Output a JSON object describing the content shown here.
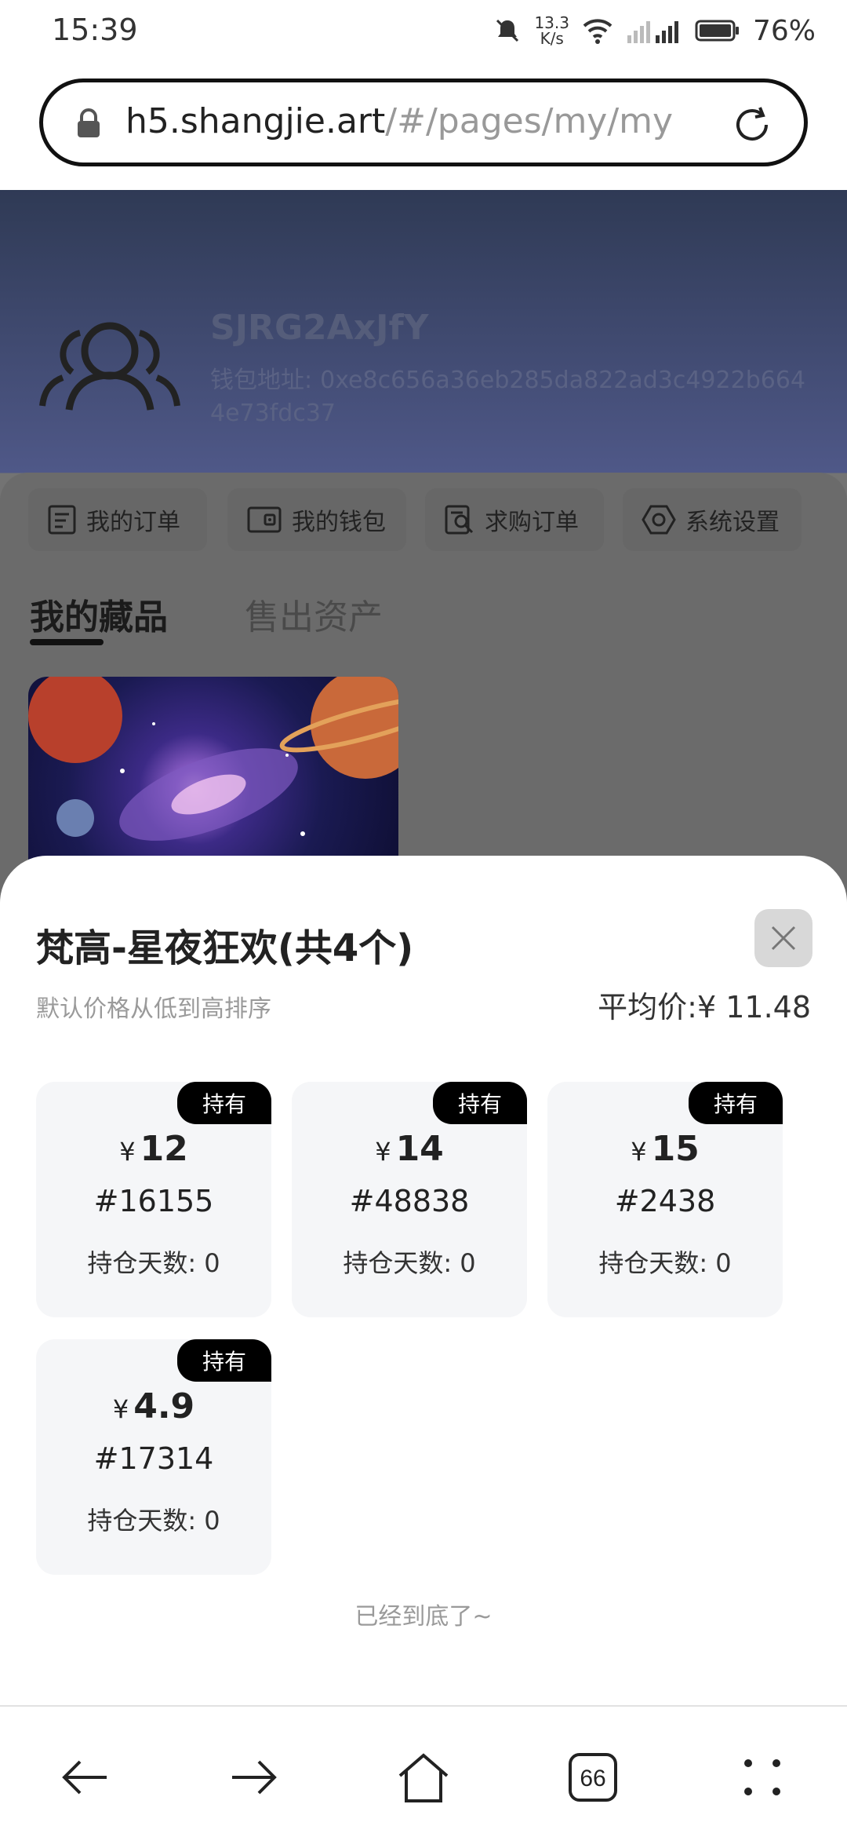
{
  "status_bar": {
    "time": "15:39",
    "net_speed_value": "13.3",
    "net_speed_unit": "K/s",
    "battery": "76%",
    "icons": [
      "mute-icon",
      "wifi-icon",
      "signal-icon",
      "battery-icon"
    ]
  },
  "url_bar": {
    "domain": "h5.shangjie.art",
    "path": "/#/pages/my/my"
  },
  "profile": {
    "name": "SJRG2AxJfY",
    "wallet_label": "钱包地址:",
    "wallet_address": "0xe8c656a36eb285da822ad3c4922b6644e73fdc37"
  },
  "quick_actions": [
    {
      "label": "我的订单",
      "icon": "orders-icon"
    },
    {
      "label": "我的钱包",
      "icon": "wallet-icon"
    },
    {
      "label": "求购订单",
      "icon": "purchase-order-icon"
    },
    {
      "label": "系统设置",
      "icon": "settings-icon"
    }
  ],
  "tabs": {
    "active": "我的藏品",
    "inactive": "售出资产"
  },
  "sheet": {
    "title": "梵高-星夜狂欢(共4个)",
    "sort_hint": "默认价格从低到高排序",
    "avg_label": "平均价:",
    "avg_value": "¥ 11.48",
    "currency": "¥",
    "items": [
      {
        "tag": "持有",
        "price": "12",
        "serial": "#16155",
        "days": "持仓天数: 0"
      },
      {
        "tag": "持有",
        "price": "14",
        "serial": "#48838",
        "days": "持仓天数: 0"
      },
      {
        "tag": "持有",
        "price": "15",
        "serial": "#2438",
        "days": "持仓天数: 0"
      },
      {
        "tag": "持有",
        "price": "4.9",
        "serial": "#17314",
        "days": "持仓天数: 0"
      }
    ],
    "end_note": "已经到底了~"
  },
  "nav": {
    "tab_count": "66",
    "icons": [
      "back-arrow-icon",
      "forward-arrow-icon",
      "home-icon",
      "tabs-icon",
      "menu-dots-icon"
    ]
  }
}
